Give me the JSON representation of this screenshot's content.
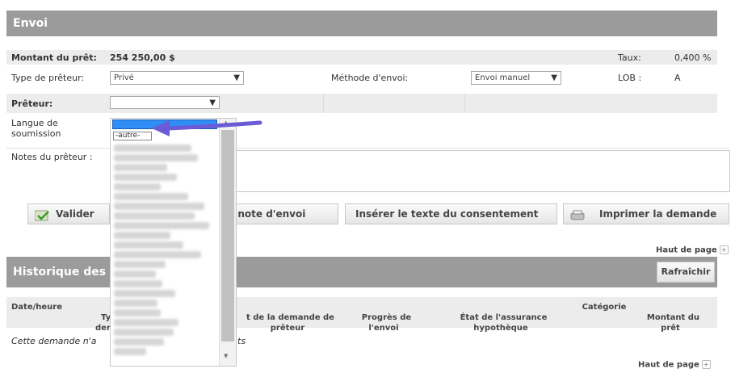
{
  "envoi": {
    "title": "Envoi",
    "montant_label": "Montant du prêt:",
    "montant_value": "254 250,00 $",
    "taux_label": "Taux:",
    "taux_value": "0,400 %",
    "type_label": "Type de prêteur:",
    "type_value": "Privé",
    "methode_label": "Méthode d'envoi:",
    "methode_value": "Envoi manuel",
    "lob_label": "LOB :",
    "lob_value": "A",
    "preteur_label": "Prêteur:",
    "preteur_value": "",
    "langue_label": "Langue de soumission",
    "notes_label": "Notes du prêteur :",
    "dropdown_selected_option": "-autre-"
  },
  "buttons": {
    "valider": "Valider",
    "note_envoi": "ère note d'envoi",
    "inserer": "Insérer le texte du consentement",
    "imprimer": "Imprimer la demande"
  },
  "links": {
    "haut_de_page": "Haut de page"
  },
  "historique": {
    "title": "Historique des",
    "refresh": "Rafraîchir",
    "columns": [
      "Date/heure",
      "Ty\nder",
      "t de la demande de\nprêteur",
      "Progrès de\nl'envoi",
      "État de l'assurance\nhypothèque",
      "Catégorie",
      "Montant du\nprêt"
    ],
    "empty_text_left": "Cette demande n'a",
    "empty_text_right": "ts"
  },
  "colors": {
    "header_gray": "#9b9b9b",
    "dropdown_highlight": "#2f8df5",
    "arrow": "#6b5bd6"
  }
}
